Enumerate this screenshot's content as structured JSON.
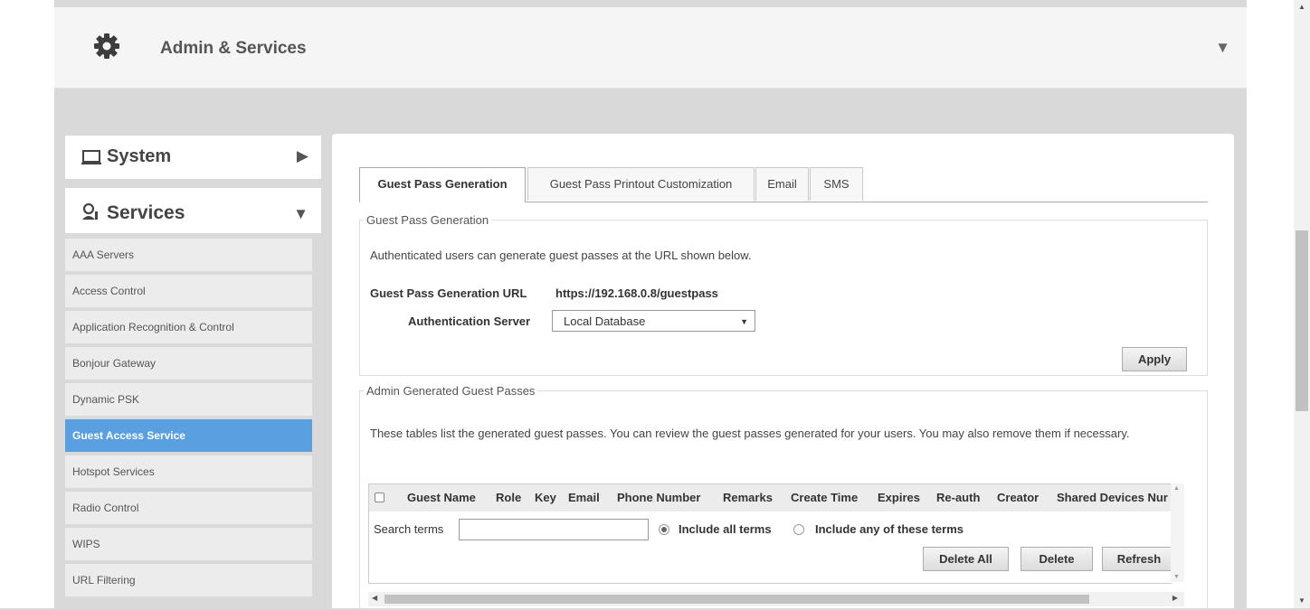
{
  "header": {
    "title": "Admin & Services",
    "icon": "gear-icon"
  },
  "sidebar": {
    "system_label": "System",
    "services_label": "Services",
    "items": [
      {
        "label": "AAA Servers"
      },
      {
        "label": "Access Control"
      },
      {
        "label": "Application Recognition & Control"
      },
      {
        "label": "Bonjour Gateway"
      },
      {
        "label": "Dynamic PSK"
      },
      {
        "label": "Guest Access Service",
        "active": true
      },
      {
        "label": "Hotspot Services"
      },
      {
        "label": "Radio Control"
      },
      {
        "label": "WIPS"
      },
      {
        "label": "URL Filtering"
      }
    ]
  },
  "tabs": [
    {
      "label": "Guest Pass Generation",
      "active": true
    },
    {
      "label": "Guest Pass Printout Customization"
    },
    {
      "label": "Email"
    },
    {
      "label": "SMS"
    }
  ],
  "guest_pass": {
    "legend": "Guest Pass Generation",
    "description": "Authenticated users can generate guest passes at the URL shown below.",
    "url_label": "Guest Pass Generation URL",
    "url_value": "https://192.168.0.8/guestpass",
    "auth_label": "Authentication Server",
    "auth_value": "Local Database",
    "apply_label": "Apply"
  },
  "admin_generated": {
    "legend": "Admin Generated Guest Passes",
    "description": "These tables list the generated guest passes. You can review the guest passes generated for your users. You may also remove them if necessary.",
    "columns": [
      "Guest Name",
      "Role",
      "Key",
      "Email",
      "Phone Number",
      "Remarks",
      "Create Time",
      "Expires",
      "Re-auth",
      "Creator",
      "Shared Devices Nur"
    ],
    "search_label": "Search terms",
    "search_value": "",
    "radio_all_label": "Include all terms",
    "radio_any_label": "Include any of these terms",
    "delete_all_label": "Delete All",
    "delete_label": "Delete",
    "refresh_label": "Refresh"
  },
  "colors": {
    "accent": "#5aa0e0",
    "background": "#d9d9d9"
  }
}
